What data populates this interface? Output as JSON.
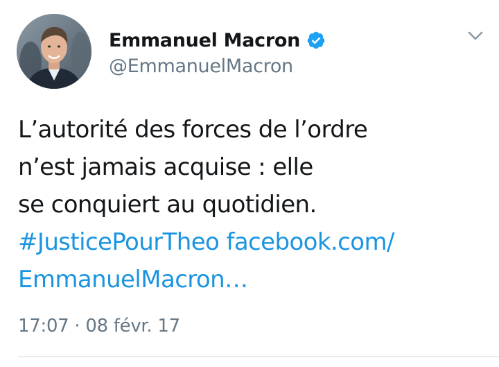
{
  "tweet": {
    "author": {
      "display_name": "Emmanuel Macron",
      "handle": "@EmmanuelMacron",
      "verified": true
    },
    "text_lines": [
      "L’autorité des forces de l’ordre",
      "n’est jamais acquise : elle",
      "se conquiert au quotidien."
    ],
    "hashtag": "#JusticePourTheo",
    "link_part1": "facebook.com/",
    "link_part2": "EmmanuelMacron…",
    "timestamp": "17:07 · 08 févr. 17"
  },
  "icons": {
    "verified": "verified-badge-icon",
    "menu": "chevron-down-icon"
  },
  "colors": {
    "link": "#1b95e0",
    "verified": "#1da1f2",
    "secondary_text": "#657786",
    "primary_text": "#14171a"
  }
}
